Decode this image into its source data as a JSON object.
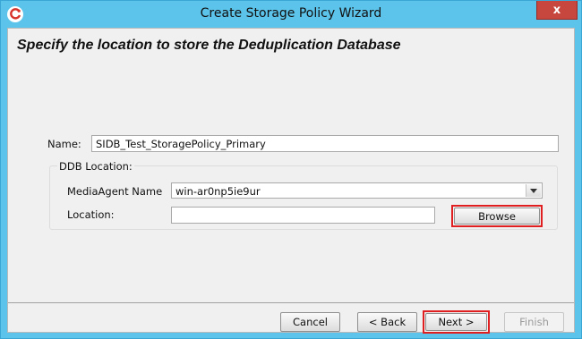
{
  "window": {
    "title": "Create Storage Policy Wizard",
    "close_glyph": "x",
    "app_icon": "commvault-logo-icon"
  },
  "page": {
    "heading": "Specify the location to store the Deduplication Database"
  },
  "form": {
    "name_label": "Name:",
    "name_value": "SIDB_Test_StoragePolicy_Primary",
    "ddb_group_label": "DDB Location:",
    "media_agent_label": "MediaAgent Name",
    "media_agent_value": "win-ar0np5ie9ur",
    "location_label": "Location:",
    "location_value": "",
    "browse_label": "Browse"
  },
  "buttons": {
    "cancel": "Cancel",
    "back": "< Back",
    "next": "Next >",
    "finish": "Finish"
  },
  "colors": {
    "titlebar": "#5cc3ea",
    "close": "#c7463e",
    "highlight": "#e02020"
  }
}
